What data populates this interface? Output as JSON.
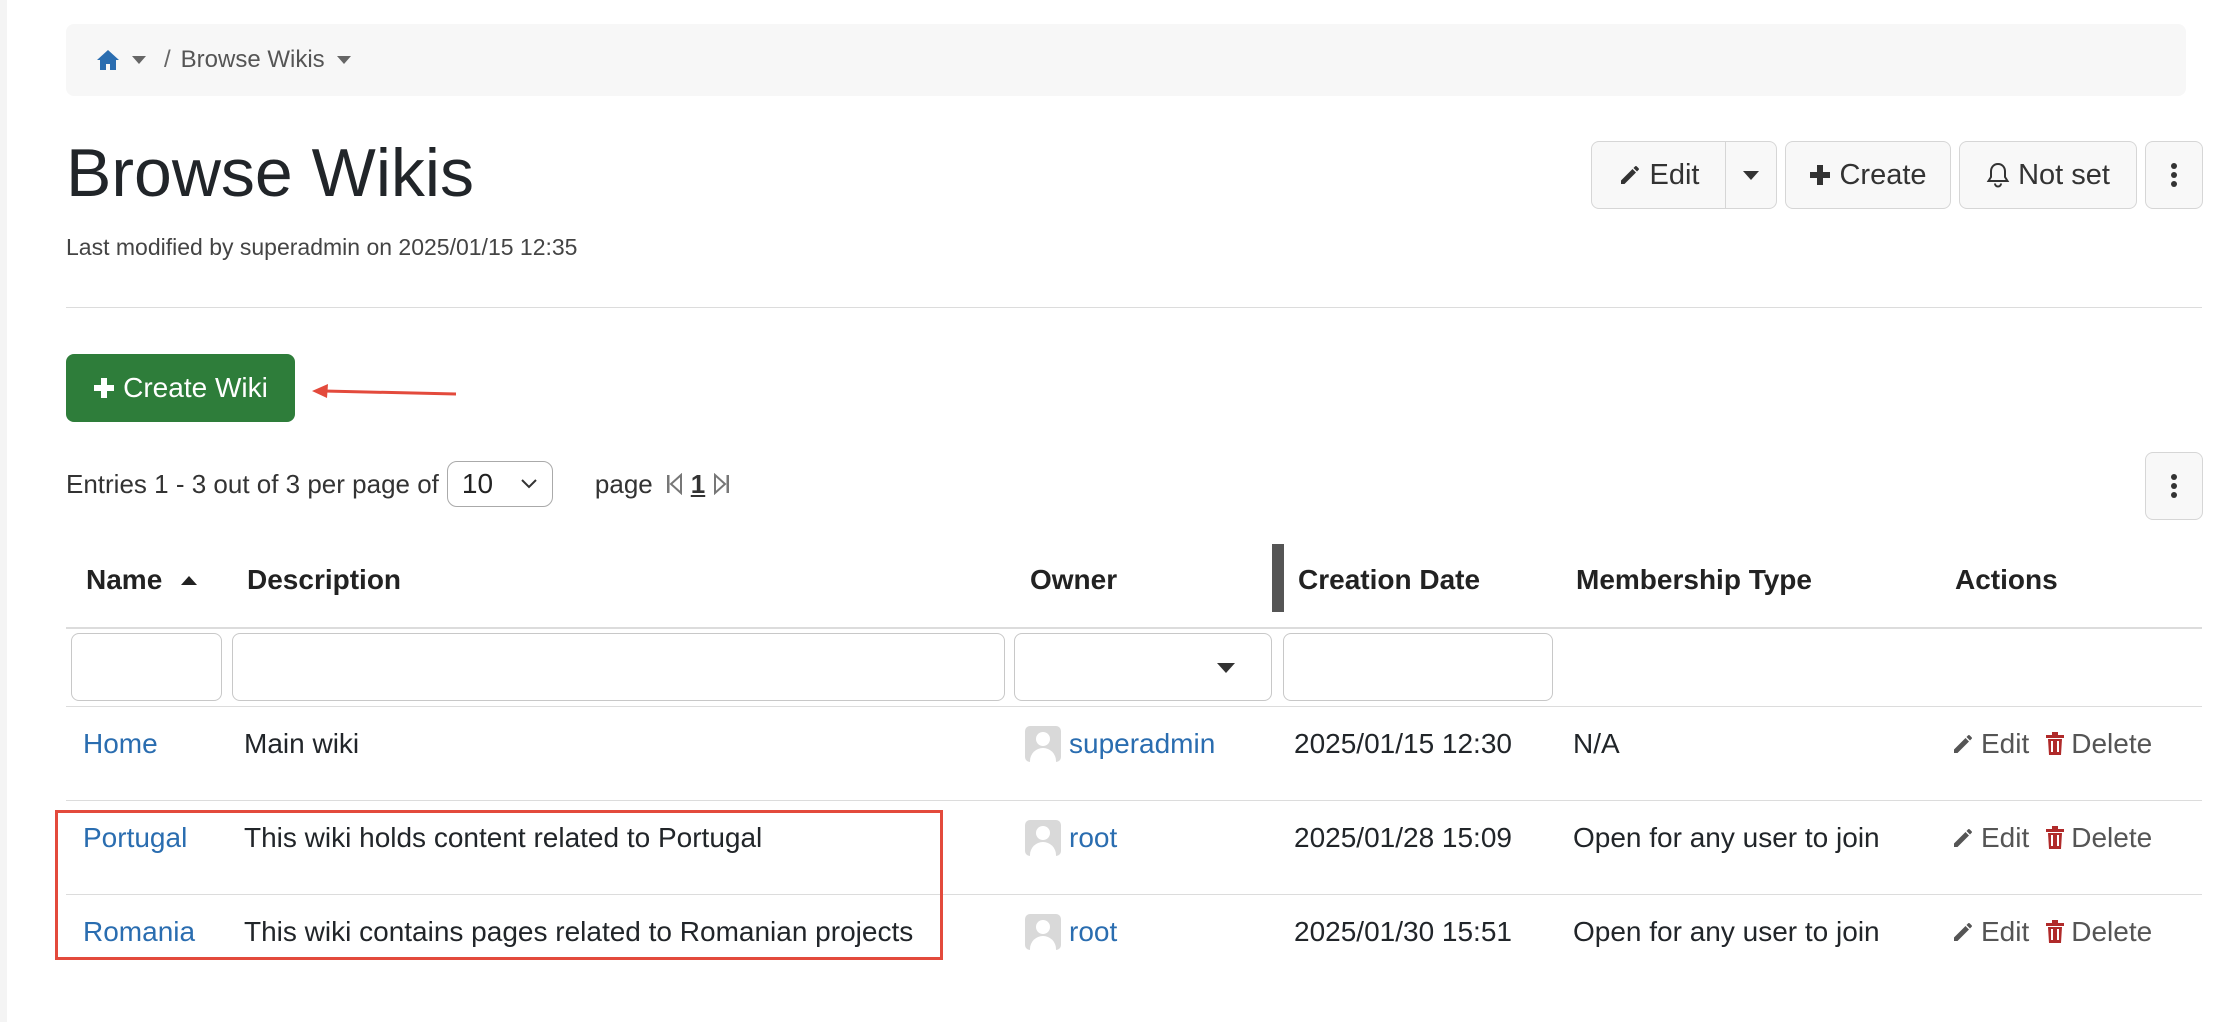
{
  "breadcrumb": {
    "home_icon": "home-icon",
    "separator": "/",
    "current": "Browse Wikis"
  },
  "header": {
    "title": "Browse Wikis",
    "last_modified": "Last modified by superadmin on 2025/01/15 12:35"
  },
  "toolbar": {
    "edit_label": "Edit",
    "create_label": "Create",
    "notify_label": "Not set"
  },
  "create_wiki_label": "Create Wiki",
  "pagination": {
    "entries_text": "Entries 1 - 3 out of 3 per page of",
    "per_page_value": "10",
    "page_label": "page",
    "current_page": "1"
  },
  "table": {
    "headers": {
      "name": "Name",
      "description": "Description",
      "owner": "Owner",
      "creation_date": "Creation Date",
      "membership_type": "Membership Type",
      "actions": "Actions"
    },
    "rows": [
      {
        "name": "Home",
        "description": "Main wiki",
        "owner": "superadmin",
        "creation_date": "2025/01/15 12:30",
        "membership_type": "N/A",
        "edit": "Edit",
        "delete": "Delete"
      },
      {
        "name": "Portugal",
        "description": "This wiki holds content related to Portugal",
        "owner": "root",
        "creation_date": "2025/01/28 15:09",
        "membership_type": "Open for any user to join",
        "edit": "Edit",
        "delete": "Delete"
      },
      {
        "name": "Romania",
        "description": "This wiki contains pages related to Romanian projects",
        "owner": "root",
        "creation_date": "2025/01/30 15:51",
        "membership_type": "Open for any user to join",
        "edit": "Edit",
        "delete": "Delete"
      }
    ]
  },
  "colors": {
    "link": "#2a6db0",
    "create_button": "#2e7d3a",
    "delete_icon": "#b02a2a",
    "annotation": "#e34a3c"
  }
}
